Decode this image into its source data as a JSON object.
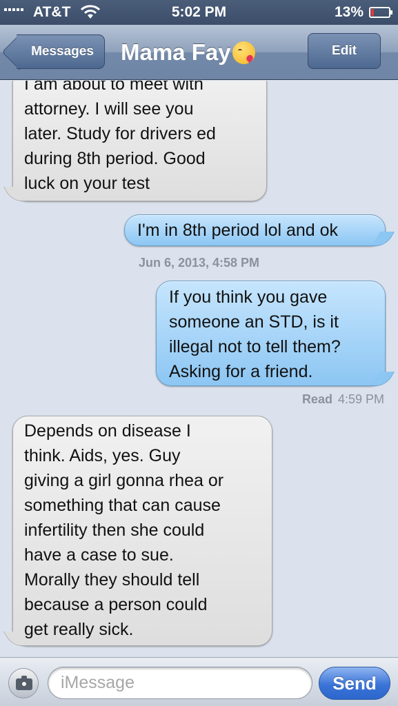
{
  "status_bar": {
    "carrier": "AT&T",
    "time": "5:02 PM",
    "battery": "13%",
    "battery_level": 0.13
  },
  "nav": {
    "back_label": "Messages",
    "title": "Mama Fay",
    "title_emoji": "kissing-face-emoji",
    "edit_label": "Edit"
  },
  "messages": [
    {
      "type": "received",
      "lines": [
        "I am about to meet with",
        "attorney. I will see you",
        "later. Study for drivers ed",
        "during 8th period. Good",
        "luck on your test"
      ]
    },
    {
      "type": "sent",
      "lines": [
        "I'm in 8th period lol and ok"
      ]
    },
    {
      "type": "timestamp",
      "text": "Jun 6, 2013, 4:58 PM"
    },
    {
      "type": "sent",
      "lines": [
        "If you think you gave",
        "someone an STD, is it",
        "illegal not to tell them?",
        "Asking for a friend."
      ]
    },
    {
      "type": "read",
      "label": "Read",
      "time": "4:59 PM"
    },
    {
      "type": "received",
      "lines": [
        "Depends on disease I",
        "think. Aids, yes. Guy",
        "giving a girl gonna rhea or",
        "something that can cause",
        "infertility then she could",
        "have a case to sue.",
        "Morally they should tell",
        "because a person could",
        "get really sick."
      ]
    }
  ],
  "input_bar": {
    "placeholder": "iMessage",
    "value": "",
    "send_label": "Send"
  },
  "colors": {
    "background": "#dbe2ed",
    "sent_bubble": "#8cc6f3",
    "received_bubble": "#dedede",
    "send_button": "#3b74d8"
  }
}
